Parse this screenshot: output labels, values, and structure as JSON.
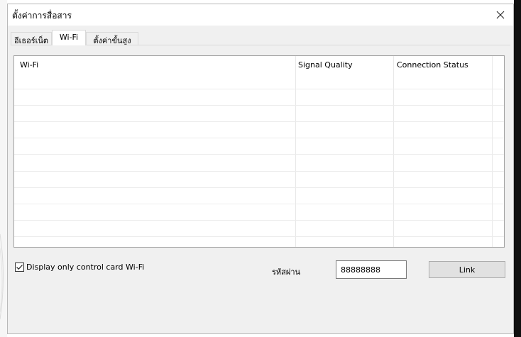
{
  "window": {
    "title": "ตั้งค่าการสื่อสาร",
    "close_icon": "close-icon"
  },
  "tabs": [
    {
      "label": "อีเธอร์เน็ต",
      "active": false
    },
    {
      "label": "Wi-Fi",
      "active": true
    },
    {
      "label": "ตั้งค่าขั้นสูง",
      "active": false
    }
  ],
  "table": {
    "columns": [
      "Wi-Fi",
      "Signal Quality",
      "Connection Status"
    ],
    "rows": []
  },
  "filter": {
    "label": "Display only control card Wi-Fi",
    "checked": true
  },
  "password": {
    "label": "รหัสผ่าน",
    "value": "88888888"
  },
  "link_button": {
    "label": "Link"
  }
}
